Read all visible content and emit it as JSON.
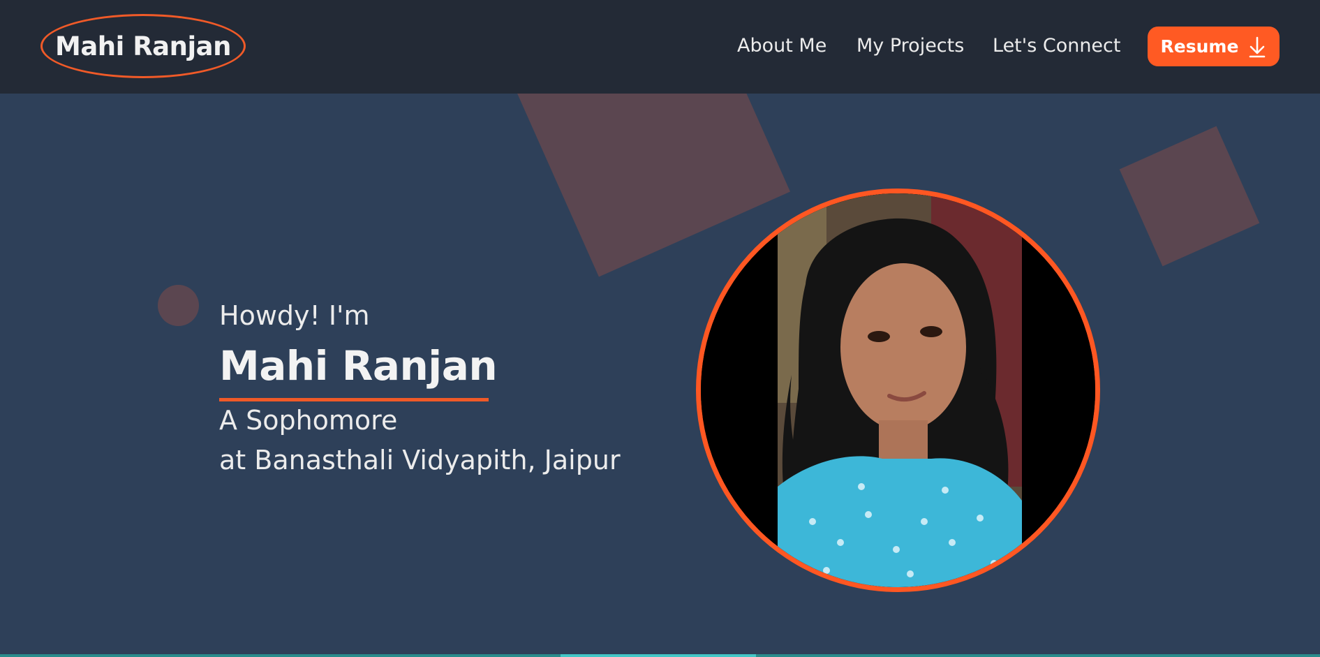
{
  "header": {
    "brand": "Mahi Ranjan",
    "nav": [
      {
        "label": "About Me"
      },
      {
        "label": "My Projects"
      },
      {
        "label": "Let's Connect"
      }
    ],
    "resume_label": "Resume",
    "resume_icon": "download-icon"
  },
  "hero": {
    "greeting": "Howdy! I'm",
    "name": "Mahi Ranjan",
    "subtitle_line1": "A Sophomore",
    "subtitle_line2": "at Banasthali Vidyapith, Jaipur"
  },
  "colors": {
    "header_bg": "#232a36",
    "page_bg": "#2e4059",
    "accent": "#ff5a23",
    "decoration": "#5b4650",
    "text": "#ececec"
  }
}
